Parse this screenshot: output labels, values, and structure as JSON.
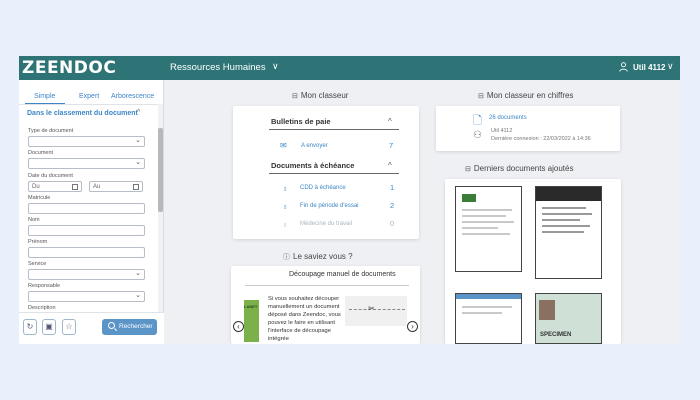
{
  "topbar": {
    "logo": "ZEENDOC",
    "workspace": "Ressources Humaines",
    "workspace_chevron": "∨",
    "user_name": "Util 4112",
    "user_chevron": "∨"
  },
  "sidebar": {
    "tabs": [
      {
        "label": "Simple",
        "active": true
      },
      {
        "label": "Expert",
        "active": false
      },
      {
        "label": "Arborescence",
        "active": false
      }
    ],
    "section_title": "Dans le classement du document",
    "section_chevron": "^",
    "fields": [
      {
        "label": "Type de document",
        "type": "select",
        "value": ""
      },
      {
        "label": "Document",
        "type": "select",
        "value": ""
      },
      {
        "label": "Date du document",
        "type": "date-range",
        "from_placeholder": "Du",
        "to_placeholder": "Au"
      },
      {
        "label": "Matricule",
        "type": "text",
        "value": ""
      },
      {
        "label": "Nom",
        "type": "text",
        "value": ""
      },
      {
        "label": "Prénom",
        "type": "text",
        "value": ""
      },
      {
        "label": "Service",
        "type": "select",
        "value": ""
      },
      {
        "label": "Responsable",
        "type": "select",
        "value": ""
      },
      {
        "label": "Description",
        "type": "text",
        "value": ""
      }
    ],
    "search_button": "Rechercher"
  },
  "classeur": {
    "title": "Mon classeur",
    "categories": [
      {
        "title": "Bulletins de paie",
        "chevron": "^",
        "rows": [
          {
            "label": "A envoyer",
            "count": "7",
            "icon": "envelope-icon",
            "muted": false
          }
        ]
      },
      {
        "title": "Documents à échéance",
        "chevron": "^",
        "rows": [
          {
            "label": "CDD à échéance",
            "count": "1",
            "icon": "bell-icon",
            "muted": false
          },
          {
            "label": "Fin de période d'essai",
            "count": "2",
            "icon": "bell-icon",
            "muted": false
          },
          {
            "label": "Médecine du travail",
            "count": "0",
            "icon": "bell-icon",
            "muted": true
          }
        ]
      }
    ]
  },
  "chiffres": {
    "title": "Mon classeur en chiffres",
    "documents_link": "26 documents",
    "user": "Util 4112",
    "last_login": "Dernière connexion : 22/03/2022 à 14:36"
  },
  "saviez": {
    "title": "Le saviez vous ?",
    "card_title": "Découpage manuel de documents",
    "body": "Si vous souhaitez découper manuellement un document déposé dans Zeendoc, vous pouvez le faire en utilisant l'interface de découpage intégrée",
    "logo_text": "LANET",
    "prev": "‹",
    "next": "›"
  },
  "derniers": {
    "title": "Derniers documents ajoutés",
    "stamp_text": "SPECIMEN"
  },
  "colors": {
    "topbar": "#2e7477",
    "accent": "#3d85c6",
    "page_bg": "#eaf0fb",
    "app_bg": "#eef0f3"
  }
}
